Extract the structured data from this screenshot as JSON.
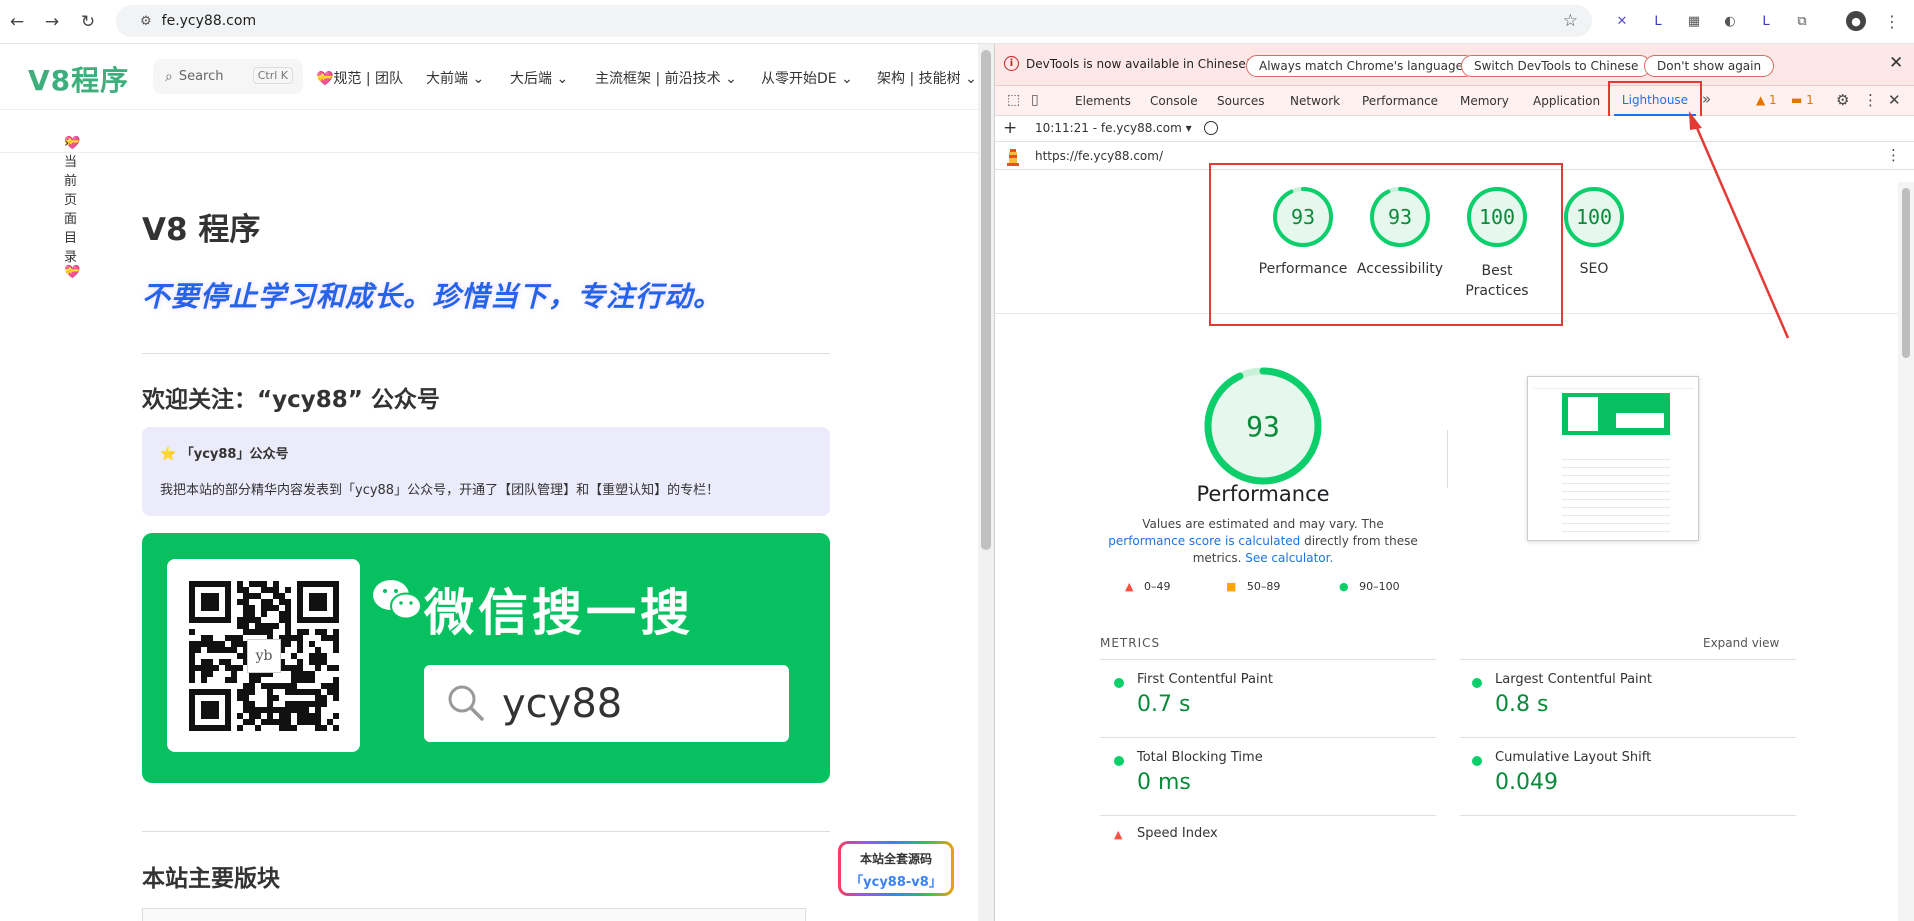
{
  "browser": {
    "url": "fe.ycy88.com"
  },
  "site": {
    "logo": "V8程序",
    "search_placeholder": "Search",
    "search_kbd": "Ctrl K",
    "nav": [
      "💝规范 | 团队",
      "大前端",
      "大后端",
      "主流框架 | 前沿技术",
      "从零开始DE",
      "架构 | 技能树"
    ],
    "subbar": "💝当前页面目录💝",
    "title": "V8 程序",
    "slogan": "不要停止学习和成长。珍惜当下，专注行动。",
    "follow_heading": "欢迎关注：“ycy88” 公众号",
    "tip_title": "「ycy88」公众号",
    "tip_body": "我把本站的部分精华内容发表到「ycy88」公众号，开通了【团队管理】和【重塑认知】的专栏！",
    "wechat_label": "微信搜一搜",
    "wechat_query": "ycy88",
    "qr_center": "yb",
    "sections_heading": "本站主要版块",
    "source_badge_line1": "本站全套源码",
    "source_badge_line2": "「ycy88-v8」"
  },
  "devtools": {
    "info_message": "DevTools is now available in Chinese!",
    "info_buttons": [
      "Always match Chrome's language",
      "Switch DevTools to Chinese",
      "Don't show again"
    ],
    "tabs": [
      "Elements",
      "Console",
      "Sources",
      "Network",
      "Performance",
      "Memory",
      "Application",
      "Lighthouse"
    ],
    "active_tab": "Lighthouse",
    "warn_count": "1",
    "issue_count": "1",
    "report_time": "10:11:21 - fe.ycy88.com",
    "report_url": "https://fe.ycy88.com/",
    "scores": [
      {
        "label": "Performance",
        "value": 93
      },
      {
        "label": "Accessibility",
        "value": 93
      },
      {
        "label": "Best\nPractices",
        "value": 100
      },
      {
        "label": "SEO",
        "value": 100
      }
    ],
    "perf_title": "Performance",
    "perf_note_1": "Values are estimated and may vary. The ",
    "perf_note_link1": "performance score is calculated",
    "perf_note_2": " directly from these metrics. ",
    "perf_note_link2": "See calculator.",
    "legend": [
      "0–49",
      "50–89",
      "90–100"
    ],
    "metrics_heading": "METRICS",
    "expand_view": "Expand view",
    "metrics": [
      {
        "name": "First Contentful Paint",
        "value": "0.7 s"
      },
      {
        "name": "Largest Contentful Paint",
        "value": "0.8 s"
      },
      {
        "name": "Total Blocking Time",
        "value": "0 ms"
      },
      {
        "name": "Cumulative Layout Shift",
        "value": "0.049"
      },
      {
        "name": "Speed Index",
        "value": ""
      }
    ],
    "colors": {
      "pass": "#0cce6b",
      "average": "#ffa400",
      "fail": "#ff4e42",
      "highlight": "#e53935"
    }
  }
}
